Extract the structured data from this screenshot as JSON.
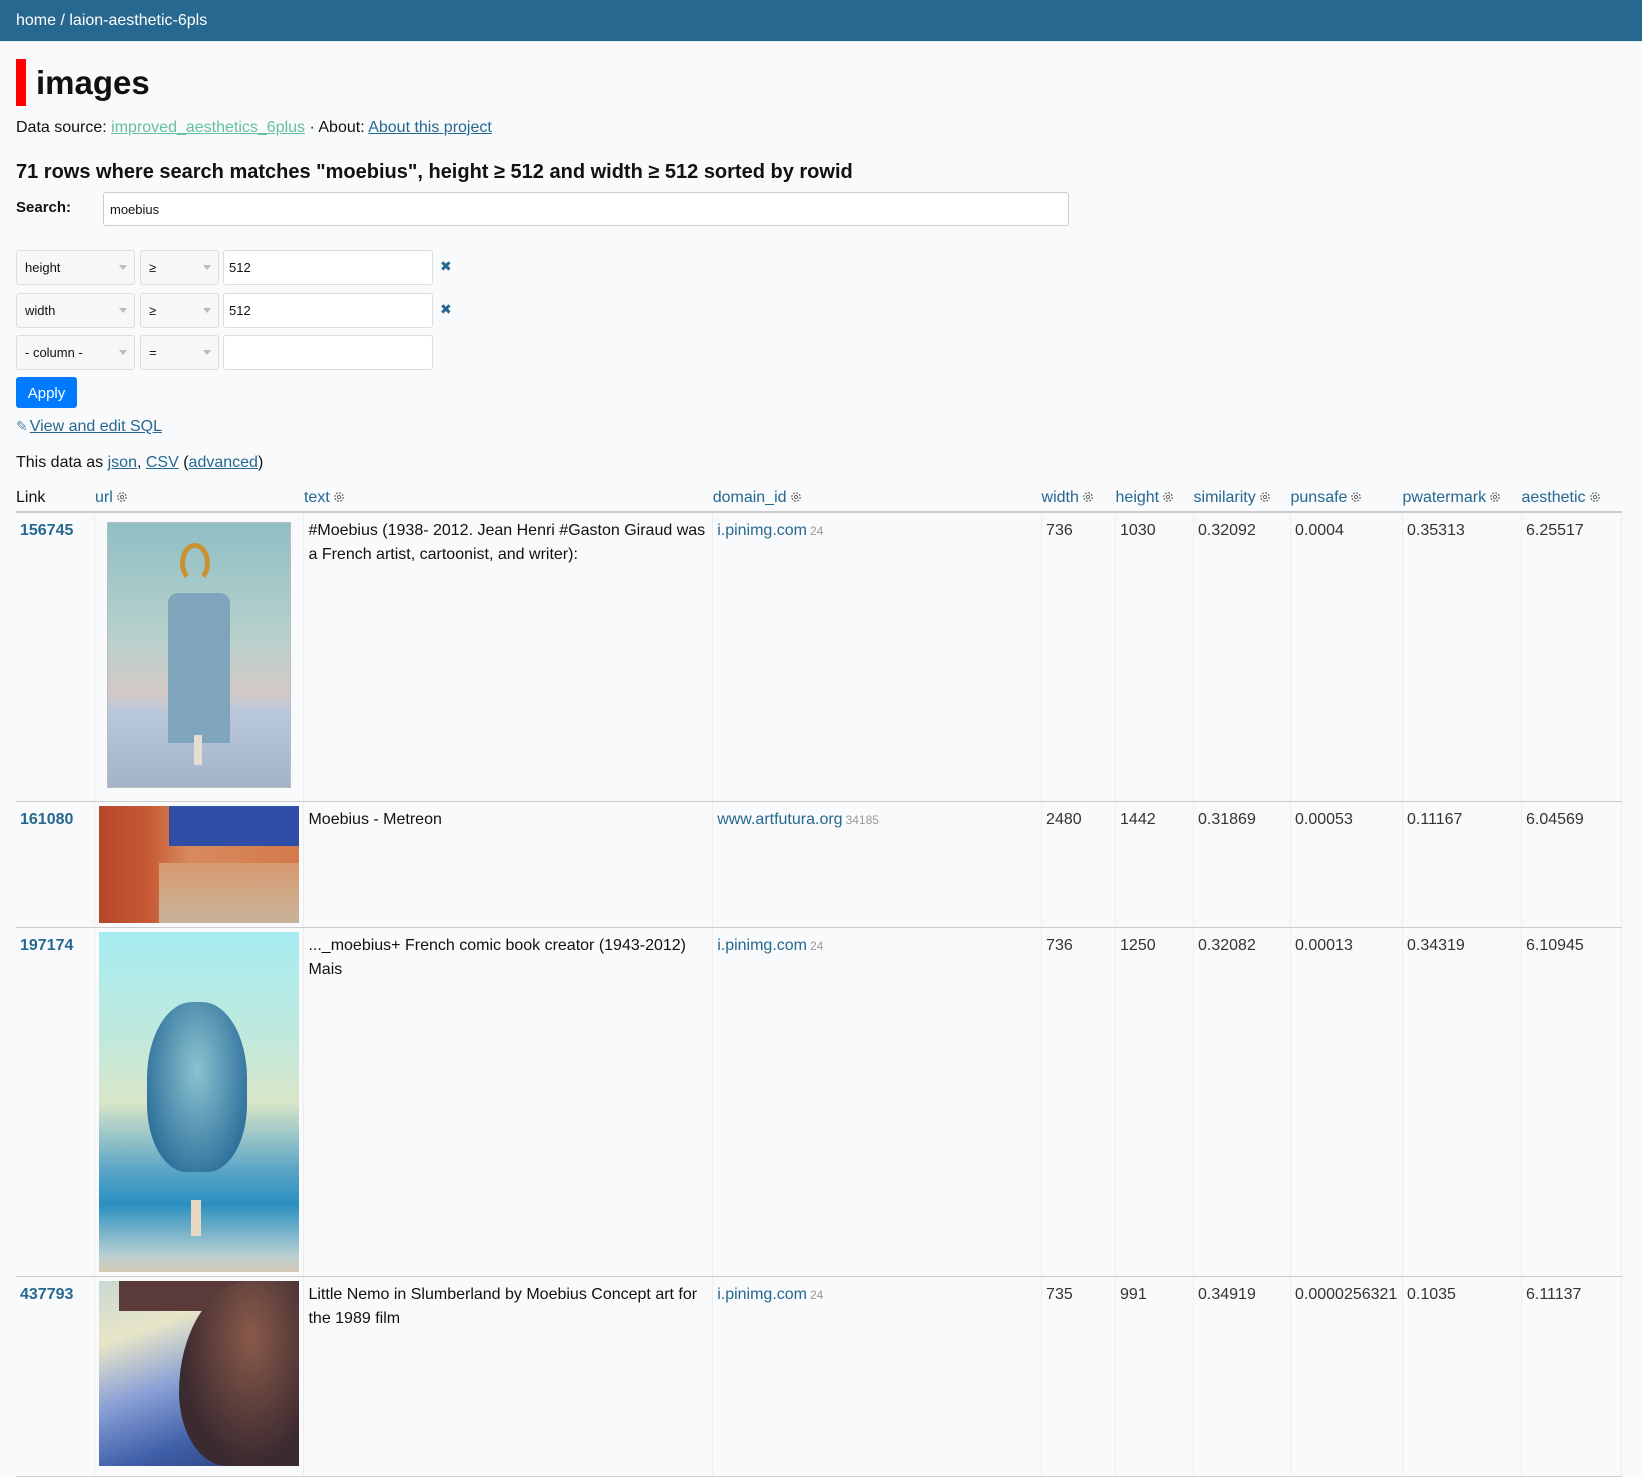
{
  "header": {
    "breadcrumb": [
      {
        "label": "home"
      },
      {
        "label": "laion-aesthetic-6pls"
      }
    ],
    "separator": " / "
  },
  "page": {
    "title": "images",
    "accent_color": "#ff0000",
    "data_source_label": "Data source: ",
    "data_source_link": "improved_aesthetics_6plus",
    "about_label": " · About: ",
    "about_link": "About this project",
    "summary": "71 rows where search matches \"moebius\", height ≥ 512 and width ≥ 512 sorted by rowid"
  },
  "search": {
    "label": "Search:",
    "value": "moebius"
  },
  "filters": [
    {
      "column": "height",
      "op": "≥",
      "value": "512",
      "removable": true
    },
    {
      "column": "width",
      "op": "≥",
      "value": "512",
      "removable": true
    },
    {
      "column": "- column -",
      "op": "=",
      "value": "",
      "removable": false
    }
  ],
  "apply_label": "Apply",
  "sql_link": "View and edit SQL",
  "export": {
    "prefix": "This data as ",
    "json": "json",
    "comma": ", ",
    "csv": "CSV",
    "open_paren": " (",
    "advanced": "advanced",
    "close_paren": ")"
  },
  "table": {
    "columns": [
      "Link",
      "url",
      "text",
      "domain_id",
      "width",
      "height",
      "similarity",
      "punsafe",
      "pwatermark",
      "aesthetic"
    ],
    "rows": [
      {
        "link": "156745",
        "url_thumb": "moebius-tower-image",
        "text": "#Moebius (1938- 2012. Jean Henri #Gaston Giraud was a French artist, cartoonist, and writer):",
        "domain": "i.pinimg.com",
        "domain_count": "24",
        "width": "736",
        "height": "1030",
        "similarity": "0.32092",
        "punsafe": "0.0004",
        "pwatermark": "0.35313",
        "aesthetic": "6.25517"
      },
      {
        "link": "161080",
        "url_thumb": "metreon-desert-image",
        "text": "Moebius - Metreon",
        "domain": "www.artfutura.org",
        "domain_count": "34185",
        "width": "2480",
        "height": "1442",
        "similarity": "0.31869",
        "punsafe": "0.00053",
        "pwatermark": "0.11167",
        "aesthetic": "6.04569"
      },
      {
        "link": "197174",
        "url_thumb": "floating-head-image",
        "text": "..._moebius+ French comic book creator (1943-2012) Mais",
        "domain": "i.pinimg.com",
        "domain_count": "24",
        "width": "736",
        "height": "1250",
        "similarity": "0.32082",
        "punsafe": "0.00013",
        "pwatermark": "0.34319",
        "aesthetic": "6.10945"
      },
      {
        "link": "437793",
        "url_thumb": "little-nemo-image",
        "text": "Little Nemo in Slumberland by Moebius Concept art for the 1989 film",
        "domain": "i.pinimg.com",
        "domain_count": "24",
        "width": "735",
        "height": "991",
        "similarity": "0.34919",
        "punsafe": "0.0000256321",
        "pwatermark": "0.1035",
        "aesthetic": "6.11137"
      }
    ]
  },
  "colors": {
    "header_bg": "#276890",
    "link": "#276890",
    "source_link": "#67c09c",
    "apply_bg": "#007bff"
  }
}
